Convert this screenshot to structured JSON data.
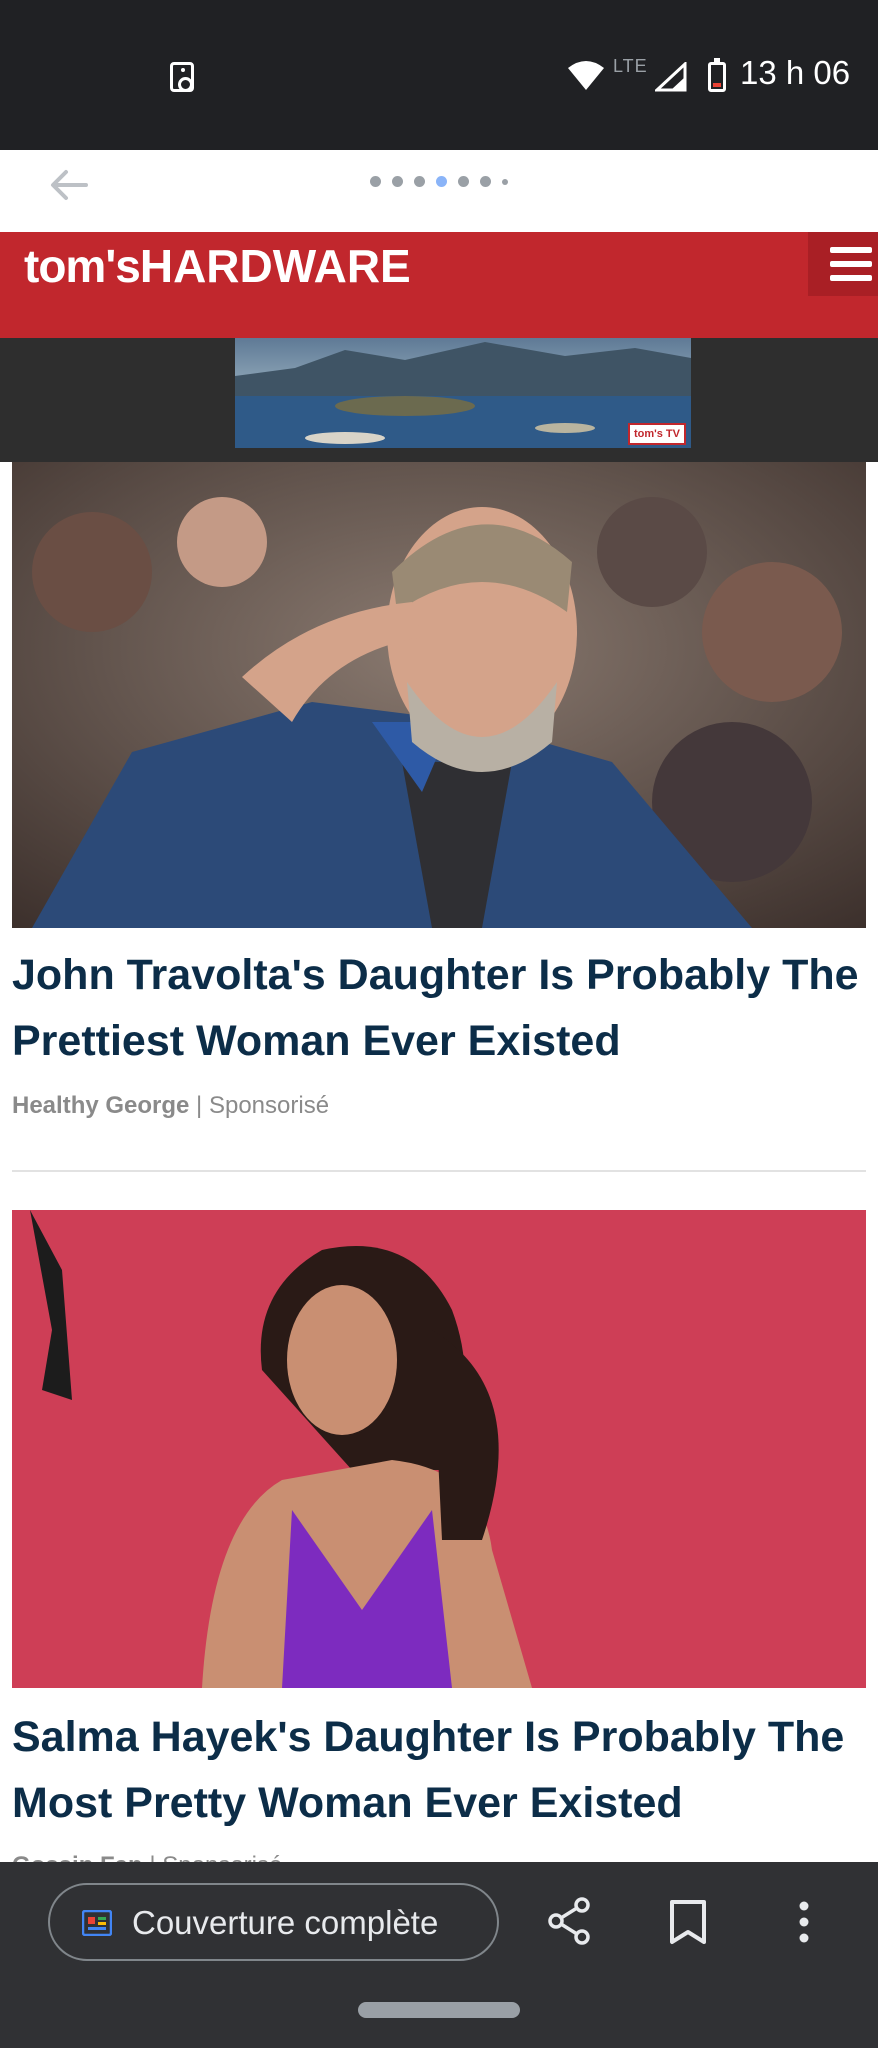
{
  "status_bar": {
    "network_label": "LTE",
    "time": "13 h 06"
  },
  "nav": {
    "page_count": 7,
    "active_page_index": 3
  },
  "site": {
    "logo_prefix": "tom's",
    "logo_suffix": "HARDWARE",
    "accent_color": "#c1272d"
  },
  "ad": {
    "badge_text": "tom's TV"
  },
  "articles": [
    {
      "title": "John Travolta's Daughter Is Probably The Prettiest Woman Ever Existed",
      "source": "Healthy George",
      "separator": " | ",
      "label": "Sponsorisé"
    },
    {
      "title": "Salma Hayek's Daughter Is Probably The Most Pretty Woman Ever Existed",
      "source": "Gossip Fan",
      "separator": " | ",
      "label": "Sponsorisé"
    }
  ],
  "bottom_bar": {
    "coverage_label": "Couverture complète",
    "icons": [
      "coverage-icon",
      "share-icon",
      "bookmark-icon",
      "more-vert-icon"
    ]
  }
}
